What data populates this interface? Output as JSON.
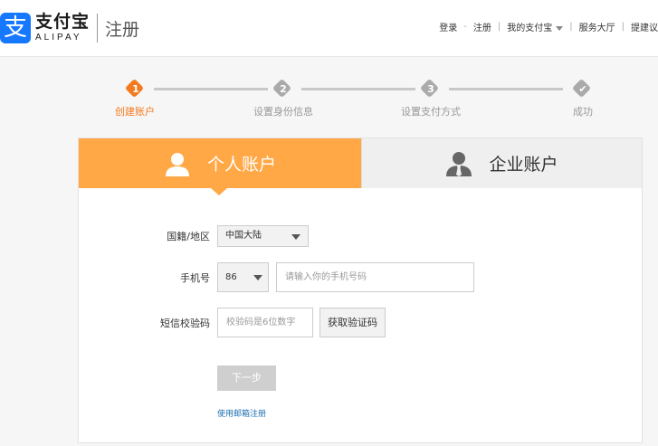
{
  "header": {
    "logo_mark": "支",
    "logo_cn": "支付宝",
    "logo_en": "ALIPAY",
    "page_title": "注册",
    "nav": {
      "login": "登录",
      "dash": "-",
      "register": "注册",
      "my_alipay": "我的支付宝",
      "service": "服务大厅",
      "suggest": "提建议"
    }
  },
  "steps": [
    {
      "number": "1",
      "label": "创建账户",
      "active": true
    },
    {
      "number": "2",
      "label": "设置身份信息",
      "active": false
    },
    {
      "number": "3",
      "label": "设置支付方式",
      "active": false
    },
    {
      "number": "✔",
      "label": "成功",
      "active": false
    }
  ],
  "tabs": {
    "personal": "个人账户",
    "company": "企业账户"
  },
  "form": {
    "region_label": "国籍/地区",
    "region_value": "中国大陆",
    "phone_label": "手机号",
    "country_code": "86",
    "phone_placeholder": "请输入你的手机号码",
    "sms_label": "短信校验码",
    "sms_placeholder": "校验码是6位数字",
    "get_code_button": "获取验证码",
    "next_button": "下一步",
    "email_register_link": "使用邮箱注册"
  },
  "colors": {
    "accent": "#f37a1f",
    "tab_active": "#ffa845",
    "brand_blue": "#1677ff",
    "link": "#1c6fb0"
  }
}
